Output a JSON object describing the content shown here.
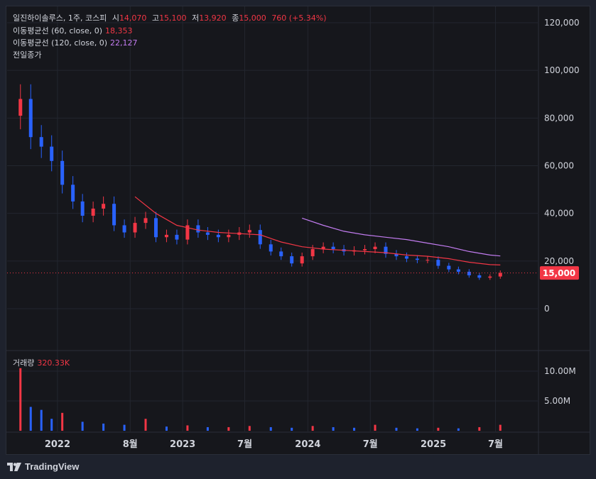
{
  "header": {
    "symbol": "일진하이솔루스, 1주, 코스피",
    "open_label": "시",
    "open": "14,070",
    "high_label": "고",
    "high": "15,100",
    "low_label": "저",
    "low": "13,920",
    "close_label": "종",
    "close": "15,000",
    "change": "760 (+5.34%)",
    "ma60_label": "이동평균선 (60, close, 0)",
    "ma60_value": "18,353",
    "ma120_label": "이동평균선 (120, close, 0)",
    "ma120_value": "22,127",
    "prev_close_label": "전일종가",
    "volume_label": "거래량",
    "volume_value": "320.33K"
  },
  "price_axis": {
    "ticks": [
      "120,000",
      "100,000",
      "80,000",
      "60,000",
      "40,000",
      "20,000",
      "0"
    ],
    "current_price_tag": "15,000"
  },
  "volume_axis": {
    "ticks": [
      "10.00M",
      "5.00M"
    ]
  },
  "time_axis": {
    "ticks": [
      "2022",
      "8월",
      "2023",
      "7월",
      "2024",
      "7월",
      "2025",
      "7월"
    ]
  },
  "branding": {
    "name": "TradingView"
  },
  "colors": {
    "up": "#f23645",
    "down": "#2962ff",
    "ma60": "#f23645",
    "ma120": "#c27cf0",
    "background": "#16171c",
    "grid": "#23262f"
  },
  "chart_data": {
    "type": "candlestick",
    "title": "일진하이솔루스, 1주, 코스피",
    "ylim": [
      -20000,
      130000
    ],
    "grid": true,
    "current_price": 15000,
    "price_series": {
      "name": "close",
      "x": [
        "2021-09",
        "2021-10",
        "2021-11",
        "2021-12",
        "2022-01",
        "2022-02",
        "2022-03",
        "2022-04",
        "2022-05",
        "2022-06",
        "2022-07",
        "2022-08",
        "2022-09",
        "2022-10",
        "2022-11",
        "2022-12",
        "2023-01",
        "2023-02",
        "2023-03",
        "2023-04",
        "2023-05",
        "2023-06",
        "2023-07",
        "2023-08",
        "2023-09",
        "2023-10",
        "2023-11",
        "2023-12",
        "2024-01",
        "2024-02",
        "2024-03",
        "2024-04",
        "2024-05",
        "2024-06",
        "2024-07",
        "2024-08",
        "2024-09",
        "2024-10",
        "2024-11",
        "2024-12",
        "2025-01",
        "2025-02",
        "2025-03",
        "2025-04",
        "2025-05",
        "2025-06",
        "2025-07"
      ],
      "values": [
        88000,
        72000,
        68000,
        62000,
        52000,
        45000,
        39000,
        42000,
        44000,
        35000,
        32000,
        36000,
        38000,
        30000,
        31000,
        29000,
        35000,
        32000,
        31000,
        30000,
        31000,
        32000,
        33000,
        27000,
        24000,
        22000,
        19000,
        22000,
        25000,
        26000,
        25000,
        24000,
        24500,
        25000,
        26000,
        23000,
        22000,
        21000,
        20500,
        20500,
        18000,
        16500,
        15500,
        14000,
        13000,
        13500,
        15000
      ]
    },
    "ma60": {
      "name": "이동평균선 (60, close, 0)",
      "x": [
        "2022-08",
        "2022-10",
        "2022-12",
        "2023-02",
        "2023-04",
        "2023-06",
        "2023-08",
        "2023-10",
        "2023-12",
        "2024-02",
        "2024-04",
        "2024-06",
        "2024-08",
        "2024-10",
        "2024-12",
        "2025-02",
        "2025-04",
        "2025-06",
        "2025-07"
      ],
      "values": [
        47000,
        40000,
        35000,
        33000,
        32000,
        31500,
        31000,
        28000,
        26000,
        25000,
        24500,
        24000,
        23500,
        22500,
        22000,
        21000,
        19500,
        18500,
        18353
      ]
    },
    "ma120": {
      "name": "이동평균선 (120, close, 0)",
      "x": [
        "2023-12",
        "2024-02",
        "2024-04",
        "2024-06",
        "2024-08",
        "2024-10",
        "2024-12",
        "2025-02",
        "2025-04",
        "2025-06",
        "2025-07"
      ],
      "values": [
        38000,
        35000,
        32500,
        31000,
        30000,
        29000,
        27500,
        26000,
        24000,
        22500,
        22127
      ]
    },
    "volume": {
      "name": "거래량",
      "ylim": [
        0,
        15000000
      ],
      "x": [
        "2021-09",
        "2021-10",
        "2021-11",
        "2021-12",
        "2022-01",
        "2022-03",
        "2022-05",
        "2022-07",
        "2022-09",
        "2022-11",
        "2023-01",
        "2023-03",
        "2023-05",
        "2023-07",
        "2023-09",
        "2023-11",
        "2024-01",
        "2024-03",
        "2024-05",
        "2024-07",
        "2024-09",
        "2024-11",
        "2025-01",
        "2025-03",
        "2025-05",
        "2025-07"
      ],
      "values": [
        10500000,
        4000000,
        3500000,
        2000000,
        3000000,
        1500000,
        1200000,
        1000000,
        2000000,
        700000,
        900000,
        600000,
        600000,
        800000,
        600000,
        500000,
        800000,
        600000,
        500000,
        1000000,
        500000,
        400000,
        500000,
        400000,
        600000,
        1000000
      ]
    }
  }
}
